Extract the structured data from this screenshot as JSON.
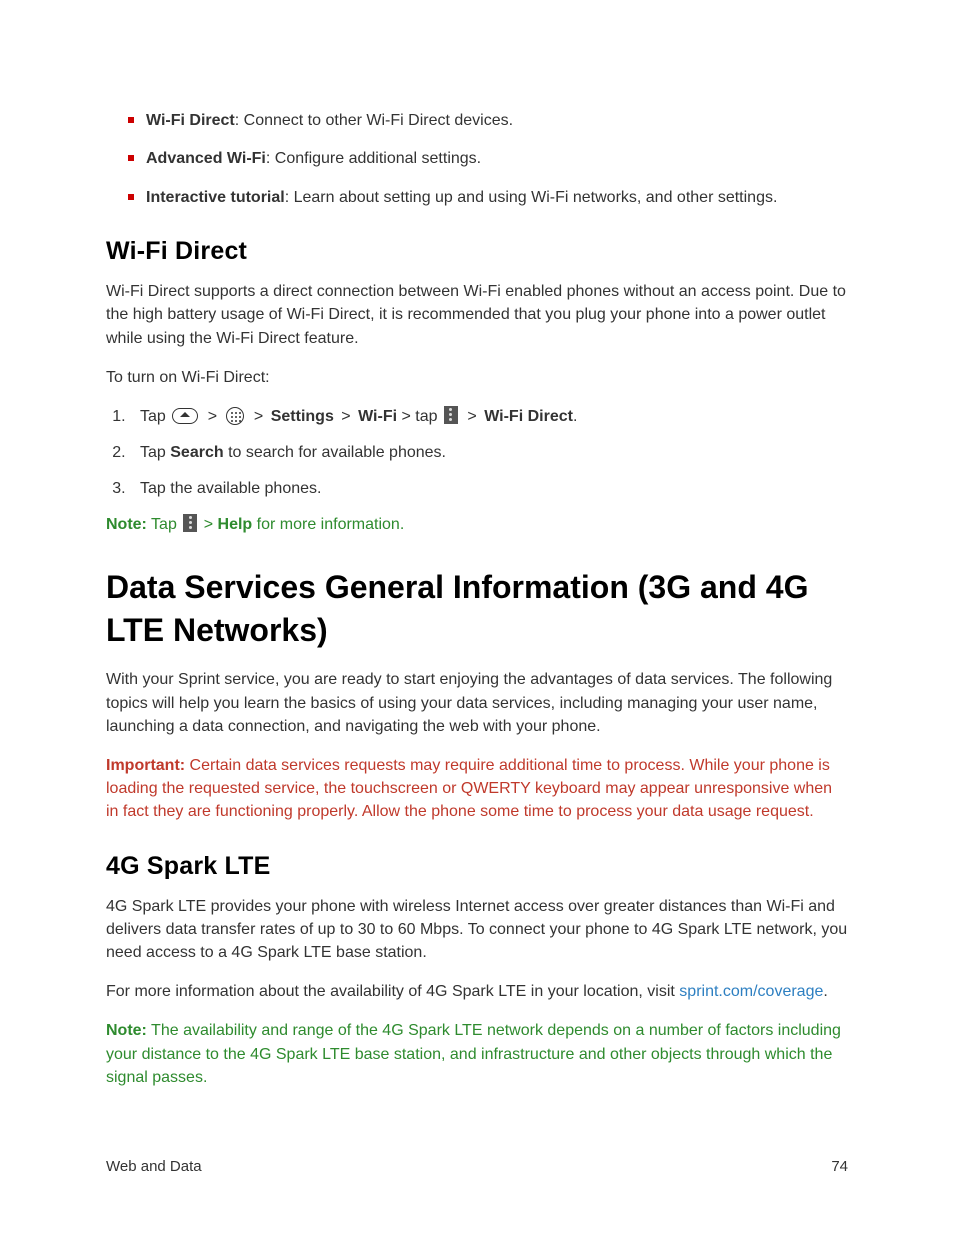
{
  "bullets": {
    "b1_term": "Wi-Fi Direct",
    "b1_desc": ": Connect to other Wi-Fi Direct devices.",
    "b2_term": "Advanced Wi-Fi",
    "b2_desc": ": Configure additional settings.",
    "b3_term": "Interactive tutorial",
    "b3_desc": ": Learn about setting up and using Wi-Fi networks, and other settings."
  },
  "wifi_direct": {
    "heading": "Wi-Fi Direct",
    "intro": "Wi-Fi Direct supports a direct connection between Wi-Fi enabled phones without an access point. Due to the high battery usage of Wi-Fi Direct, it is recommended that you plug your phone into a power outlet while using the Wi-Fi Direct feature.",
    "lead": "To turn on Wi-Fi Direct:",
    "step1": {
      "prefix": "Tap ",
      "gt": " > ",
      "settings": "Settings",
      "wifi": "Wi-Fi",
      "tap": " > tap ",
      "wfd": "Wi-Fi Direct",
      "period": "."
    },
    "step2_pre": "Tap ",
    "step2_bold": "Search",
    "step2_post": " to search for available phones.",
    "step3": "Tap the available phones.",
    "note": {
      "label": "Note:",
      "pre": " Tap ",
      "gt": " > ",
      "help": "Help",
      "post": " for more information."
    }
  },
  "data_services": {
    "heading": "Data Services General Information (3G and 4G LTE Networks)",
    "intro": "With your Sprint service, you are ready to start enjoying the advantages of data services. The following topics will help you learn the basics of using your data services, including managing your user name, launching a data connection, and navigating the web with your phone.",
    "important_label": "Important:",
    "important_body": " Certain data services requests may require additional time to process. While your phone is loading the requested service, the touchscreen or QWERTY keyboard may appear unresponsive when in fact they are functioning properly. Allow the phone some time to process your data usage request."
  },
  "spark": {
    "heading": "4G Spark LTE",
    "p1": "4G Spark LTE provides your phone with wireless Internet access over greater distances than Wi-Fi and delivers data transfer rates of up to 30 to 60 Mbps. To connect your phone to 4G Spark LTE network, you need access to a 4G Spark LTE base station.",
    "p2_pre": "For more information about the availability of 4G Spark LTE in your location, visit ",
    "p2_link": "sprint.com/coverage",
    "p2_post": ".",
    "note_label": "Note:",
    "note_body": " The availability and range of the 4G Spark LTE network depends on a number of factors including your distance to the 4G Spark LTE base station, and infrastructure and other objects through which the signal passes."
  },
  "footer": {
    "section": "Web and Data",
    "page": "74"
  }
}
